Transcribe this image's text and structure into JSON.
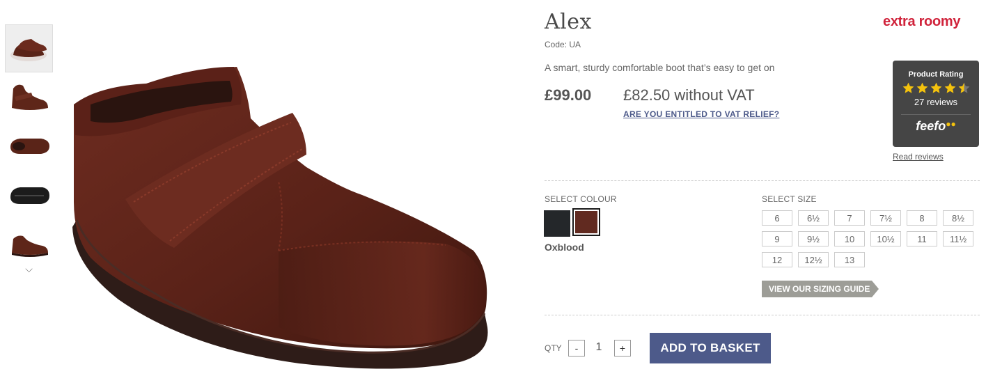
{
  "product": {
    "title": "Alex",
    "code": "Code: UA",
    "brand": "extra roomy",
    "description": "A smart, sturdy comfortable boot that’s easy to get on",
    "price": "£99.00",
    "price_ex_vat": "£82.50 without VAT",
    "vat_link": "ARE YOU ENTITLED TO VAT RELIEF?"
  },
  "rating": {
    "title": "Product Rating",
    "stars": 4.5,
    "max_stars": 5,
    "reviews": "27 reviews",
    "logo": "feefo",
    "read_reviews": "Read reviews",
    "star_color": "#f4c20d"
  },
  "gallery": {
    "thumbnails": [
      "shoe-pair-thumbnail",
      "shoe-side-thumbnail",
      "shoe-top-thumbnail",
      "shoe-sole-thumbnail",
      "shoe-profile-thumbnail"
    ],
    "active_index": 0,
    "scroll_icon": "chevron-down-icon",
    "down_glyph": "⌵"
  },
  "colour": {
    "label": "SELECT COLOUR",
    "options": [
      {
        "name": "Black",
        "hex": "#24272a"
      },
      {
        "name": "Oxblood",
        "hex": "#612a20"
      }
    ],
    "selected": "Oxblood"
  },
  "size": {
    "label": "SELECT SIZE",
    "options": [
      "6",
      "6½",
      "7",
      "7½",
      "8",
      "8½",
      "9",
      "9½",
      "10",
      "10½",
      "11",
      "11½",
      "12",
      "12½",
      "13"
    ],
    "sizing_guide": "VIEW OUR SIZING GUIDE"
  },
  "purchase": {
    "qty_label": "QTY",
    "minus": "-",
    "quantity": "1",
    "plus": "+",
    "add_to_basket": "ADD TO BASKET",
    "button_color": "#4d5a8a"
  }
}
